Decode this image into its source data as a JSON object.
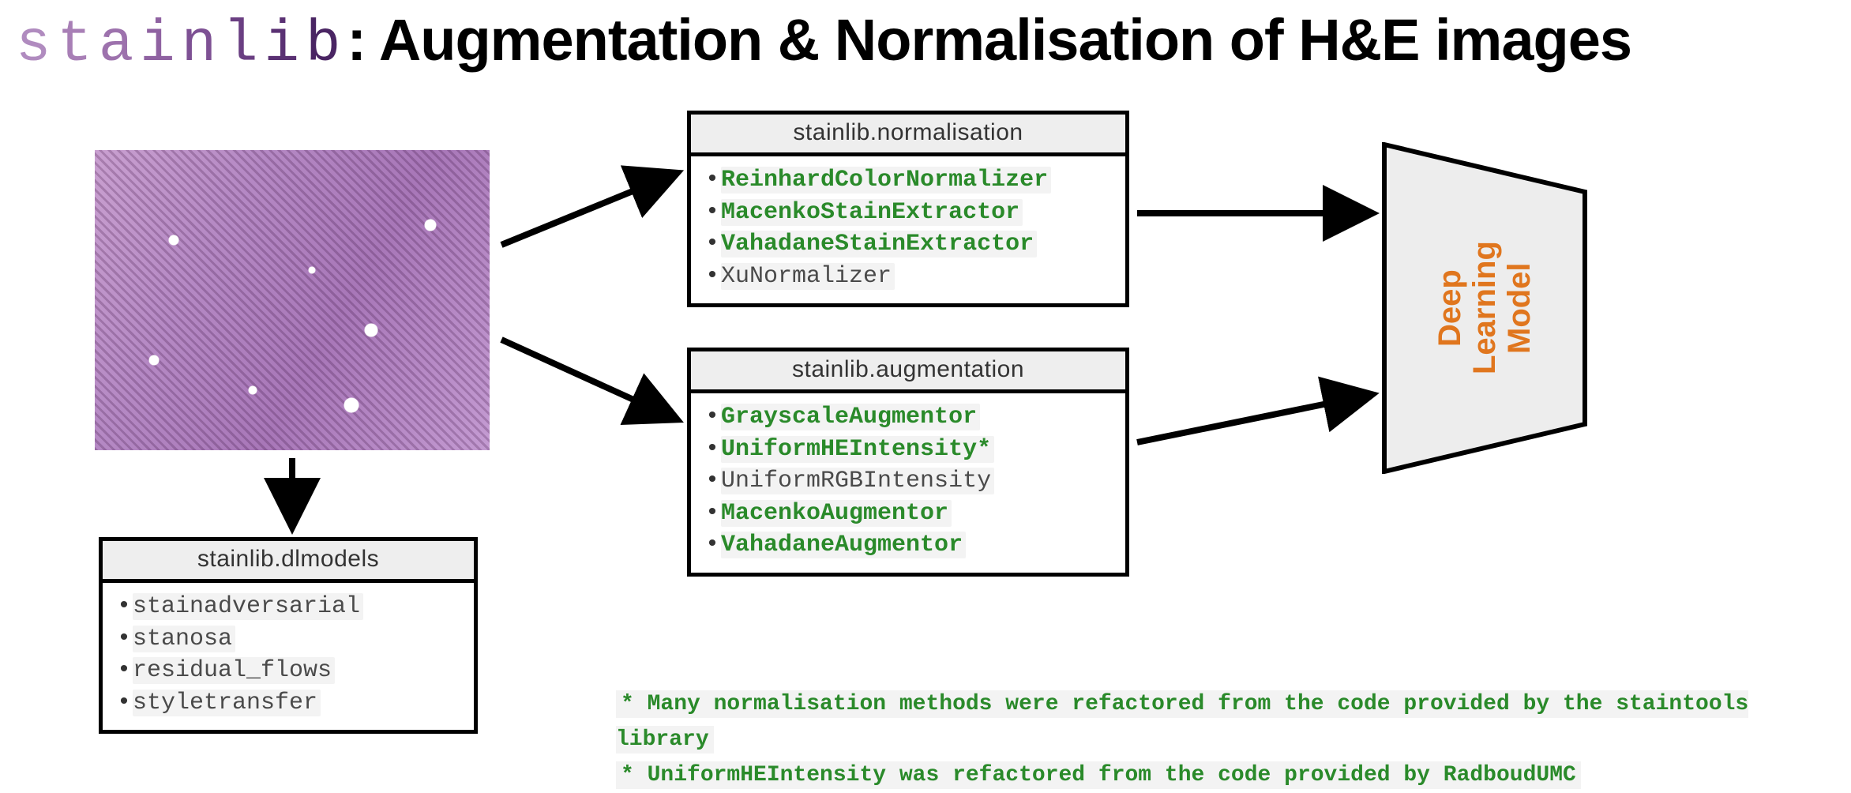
{
  "title": {
    "logo_chars": [
      {
        "c": "s",
        "color": "#b08bbf"
      },
      {
        "c": "t",
        "color": "#a87fb6"
      },
      {
        "c": "a",
        "color": "#9d72ad"
      },
      {
        "c": "i",
        "color": "#8f62a1"
      },
      {
        "c": "n",
        "color": "#7e5194"
      },
      {
        "c": "l",
        "color": "#6a3f82"
      },
      {
        "c": "i",
        "color": "#5a3173"
      },
      {
        "c": "b",
        "color": "#4a2563"
      }
    ],
    "suffix": ": Augmentation & Normalisation of H&E images"
  },
  "boxes": {
    "normalisation": {
      "header": "stainlib.normalisation",
      "items": [
        {
          "label": "ReinhardColorNormalizer",
          "style": "green"
        },
        {
          "label": "MacenkoStainExtractor",
          "style": "green"
        },
        {
          "label": "VahadaneStainExtractor",
          "style": "green"
        },
        {
          "label": "XuNormalizer",
          "style": "gray"
        }
      ]
    },
    "augmentation": {
      "header": "stainlib.augmentation",
      "items": [
        {
          "label": "GrayscaleAugmentor",
          "style": "green"
        },
        {
          "label": "UniformHEIntensity*",
          "style": "green"
        },
        {
          "label": "UniformRGBIntensity",
          "style": "gray"
        },
        {
          "label": "MacenkoAugmentor",
          "style": "green"
        },
        {
          "label": "VahadaneAugmentor",
          "style": "green"
        }
      ]
    },
    "dlmodels": {
      "header": "stainlib.dlmodels",
      "items": [
        {
          "label": "stainadversarial",
          "style": "gray"
        },
        {
          "label": "stanosa",
          "style": "gray"
        },
        {
          "label": "residual_flows",
          "style": "gray"
        },
        {
          "label": "styletransfer",
          "style": "gray"
        }
      ]
    }
  },
  "dl_label": "Deep Learning Model",
  "footnotes": [
    "* Many normalisation methods were refactored from the code provided by the staintools library",
    "* UniformHEIntensity was refactored from the code provided by RadboudUMC"
  ]
}
